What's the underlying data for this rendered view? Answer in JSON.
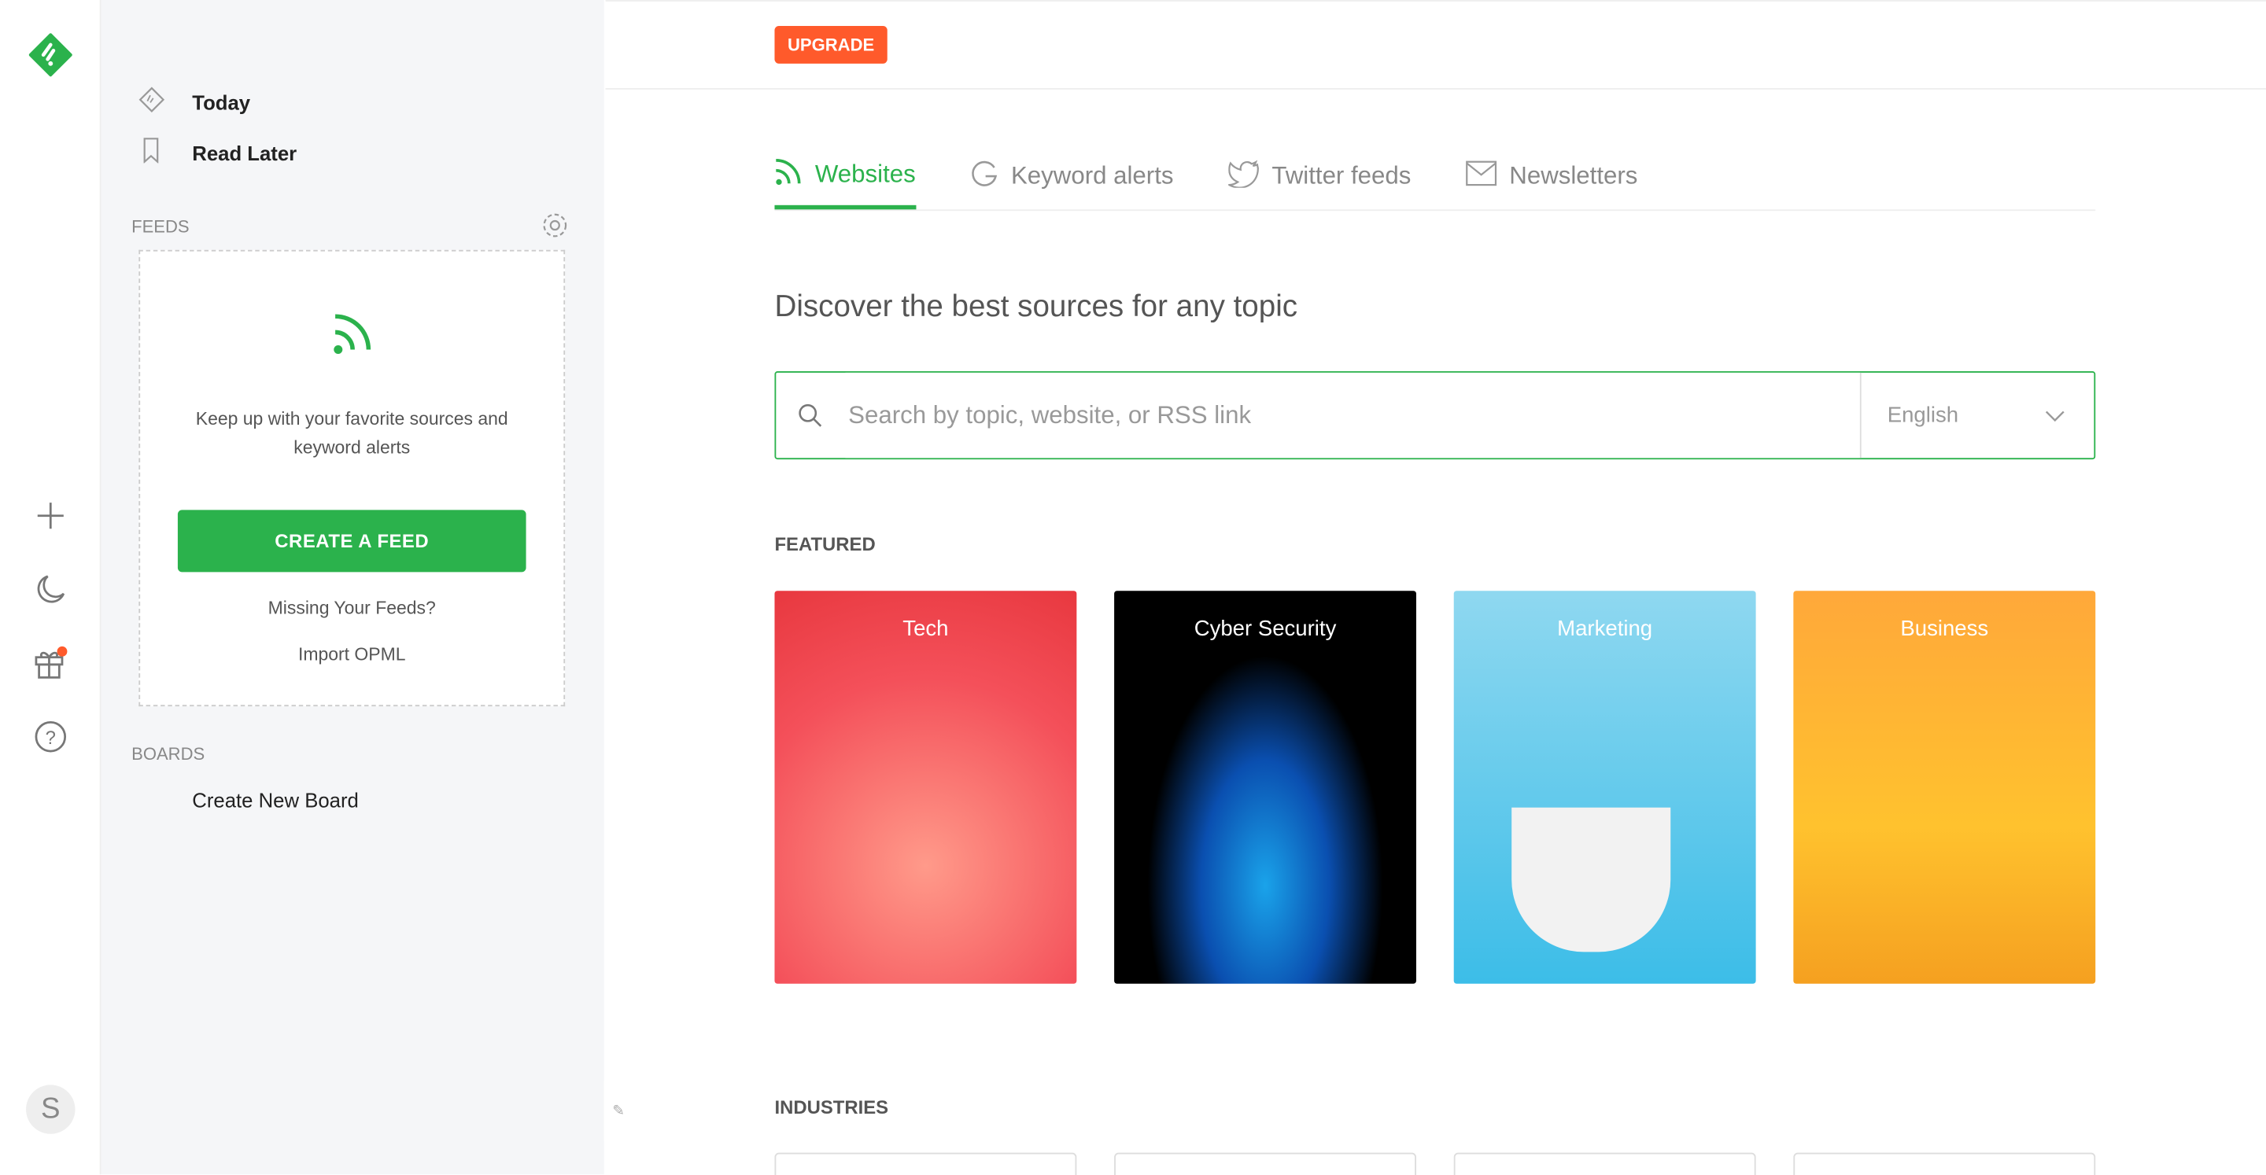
{
  "rail": {
    "avatar_initial": "S",
    "icons": [
      "feedly-logo",
      "plus-icon",
      "moon-icon",
      "gift-icon",
      "help-icon"
    ],
    "notification_color": "#ff5a2b"
  },
  "sidebar": {
    "nav": [
      {
        "label": "Today",
        "icon": "today-icon"
      },
      {
        "label": "Read Later",
        "icon": "bookmark-icon"
      }
    ],
    "feeds_title": "FEEDS",
    "empty_text": "Keep up with your favorite sources and keyword alerts",
    "create_feed": "CREATE A FEED",
    "missing": "Missing Your Feeds?",
    "import": "Import OPML",
    "boards_title": "BOARDS",
    "create_board": "Create New Board"
  },
  "main": {
    "upgrade": "UPGRADE",
    "tabs": [
      {
        "label": "Websites",
        "active": true
      },
      {
        "label": "Keyword alerts"
      },
      {
        "label": "Twitter feeds"
      },
      {
        "label": "Newsletters"
      }
    ],
    "heading": "Discover the best sources for any topic",
    "search_placeholder": "Search by topic, website, or RSS link",
    "language": "English",
    "featured_title": "FEATURED",
    "featured": [
      {
        "label": "Tech"
      },
      {
        "label": "Cyber Security"
      },
      {
        "label": "Marketing"
      },
      {
        "label": "Business"
      }
    ],
    "industries_title": "INDUSTRIES"
  },
  "colors": {
    "accent": "#2bb24c",
    "upgrade": "#ff5a2b"
  }
}
